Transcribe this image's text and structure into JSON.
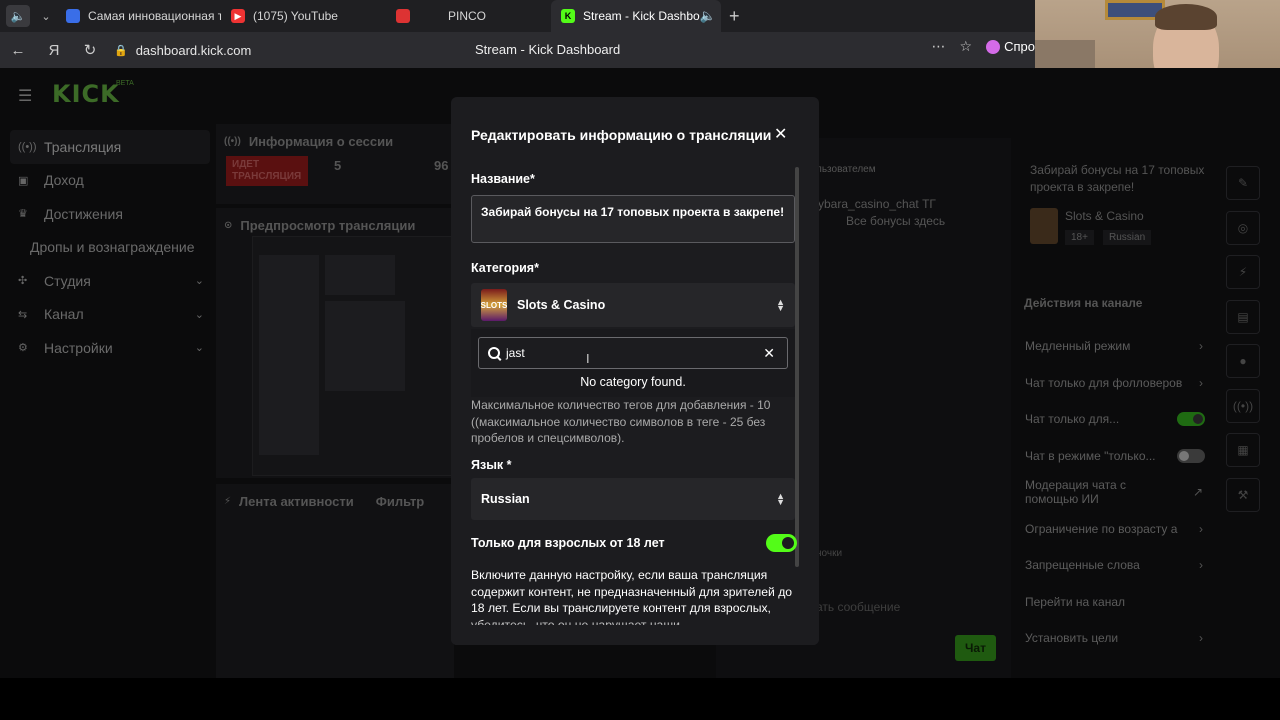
{
  "browser": {
    "tabs": [
      {
        "label": "Самая инновационная то",
        "color": "#3a6ee8",
        "active": false
      },
      {
        "label": "(1075) YouTube",
        "color": "#e33",
        "active": false
      },
      {
        "label": "PINCO",
        "color": "#d33",
        "active": false
      },
      {
        "label": "Stream - Kick Dashbo",
        "color": "#53fc18",
        "active": true
      }
    ],
    "url": "dashboard.kick.com",
    "page_title": "Stream - Kick Dashboard",
    "ask_label": "Спро"
  },
  "sidebar": {
    "logo": "KICK",
    "logo_badge": "BETA",
    "items": [
      {
        "label": "Трансляция",
        "icon": "broadcast-icon"
      },
      {
        "label": "Доход",
        "icon": "wallet-icon"
      },
      {
        "label": "Достижения",
        "icon": "trophy-icon"
      },
      {
        "label": "Дропы и вознаграждение",
        "icon": ""
      },
      {
        "label": "Студия",
        "icon": "studio-icon"
      },
      {
        "label": "Канал",
        "icon": "channel-icon"
      },
      {
        "label": "Настройки",
        "icon": "gear-icon"
      }
    ]
  },
  "session": {
    "title": "Информация о сессии",
    "live_badge": "ИДЕТ ТРАНСЛЯЦИЯ",
    "stat1": "5",
    "stat2": "96"
  },
  "preview": {
    "title": "Предпросмотр трансляции"
  },
  "activity": {
    "title": "Лента активности",
    "filter": "Фильтр"
  },
  "chat": {
    "users_label": "льзователем",
    "line1": "ybara_casino_chat ТГ",
    "line2": "Все бонусы здесь",
    "input_placeholder": "ать сообщение",
    "send_label": "Чат",
    "chip_label": "ночки"
  },
  "stream_info": {
    "title_label": "трансляции",
    "title": "Забирай бонусы на 17 топовых проекта в закрепе!",
    "category": "Slots & Casino",
    "tags": [
      "18+",
      "Russian"
    ]
  },
  "channel_actions": {
    "title": "Действия на канале",
    "items": [
      {
        "label": "Медленный режим",
        "control": "chevron"
      },
      {
        "label": "Чат только для фолловеров",
        "control": "chevron"
      },
      {
        "label": "Чат только для...",
        "control": "toggle-on"
      },
      {
        "label": "Чат в режиме \"только...",
        "control": "toggle-off"
      },
      {
        "label": "Модерация чата с помощью ИИ",
        "control": "external"
      },
      {
        "label": "Ограничение по возрасту а",
        "control": "chevron"
      },
      {
        "label": "Запрещенные слова",
        "control": "chevron"
      },
      {
        "label": "Перейти на канал",
        "control": "none"
      },
      {
        "label": "Установить цели",
        "control": "chevron"
      }
    ]
  },
  "modal": {
    "title": "Редактировать информацию о трансляции",
    "name_label": "Название*",
    "name_value": "Забирай бонусы на 17 топовых проекта в закрепе!",
    "category_label": "Категория*",
    "category_value": "Slots & Casino",
    "category_thumb": "SLOTS",
    "search_value": "jast",
    "no_results": "No category found.",
    "tags_hint": "Максимальное количество тегов для добавления - 10 ((максимальное количество символов в теге - 25 без пробелов и спецсимволов).",
    "language_label": "Язык *",
    "language_value": "Russian",
    "adult_label": "Только для взрослых от 18 лет",
    "adult_enabled": true,
    "adult_desc": "Включите данную настройку, если ваша трансляция содержит контент, не предназначенный для зрителей до 18 лет. Если вы транслируете контент для взрослых, убедитесь, что он не нарушает наши"
  },
  "colors": {
    "accent": "#53fc18",
    "modal_bg": "#1c1c1f"
  }
}
